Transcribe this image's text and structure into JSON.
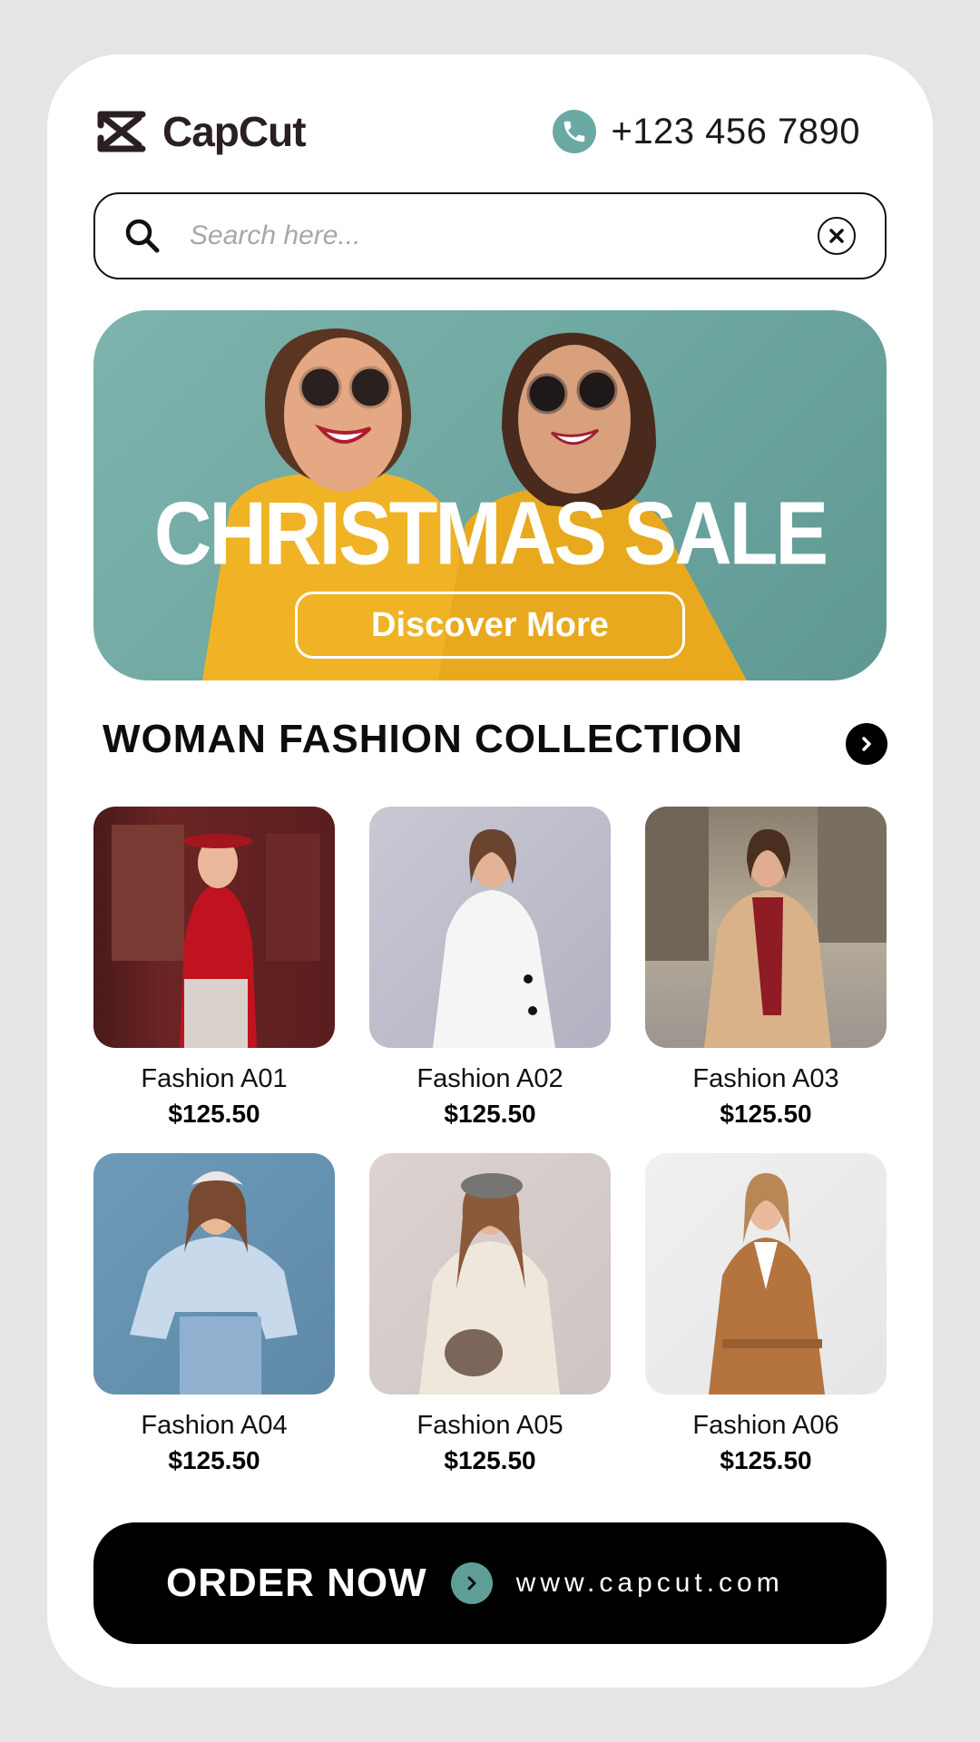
{
  "brand": {
    "name": "CapCut"
  },
  "contact": {
    "phone": "+123 456 7890"
  },
  "search": {
    "placeholder": "Search here..."
  },
  "banner": {
    "title": "CHRISTMAS SALE",
    "button_label": "Discover More"
  },
  "collection": {
    "title": "WOMAN FASHION COLLECTION",
    "products": [
      {
        "name": "Fashion A01",
        "price": "$125.50"
      },
      {
        "name": "Fashion A02",
        "price": "$125.50"
      },
      {
        "name": "Fashion A03",
        "price": "$125.50"
      },
      {
        "name": "Fashion A04",
        "price": "$125.50"
      },
      {
        "name": "Fashion A05",
        "price": "$125.50"
      },
      {
        "name": "Fashion A06",
        "price": "$125.50"
      }
    ]
  },
  "order": {
    "label": "ORDER NOW",
    "url": "www.capcut.com"
  },
  "colors": {
    "accent": "#6aa9a4",
    "banner_bg": "#6da6a0",
    "dark": "#000000"
  },
  "icons": [
    "capcut-logo-icon",
    "phone-icon",
    "search-icon",
    "clear-icon",
    "chevron-right-icon"
  ]
}
